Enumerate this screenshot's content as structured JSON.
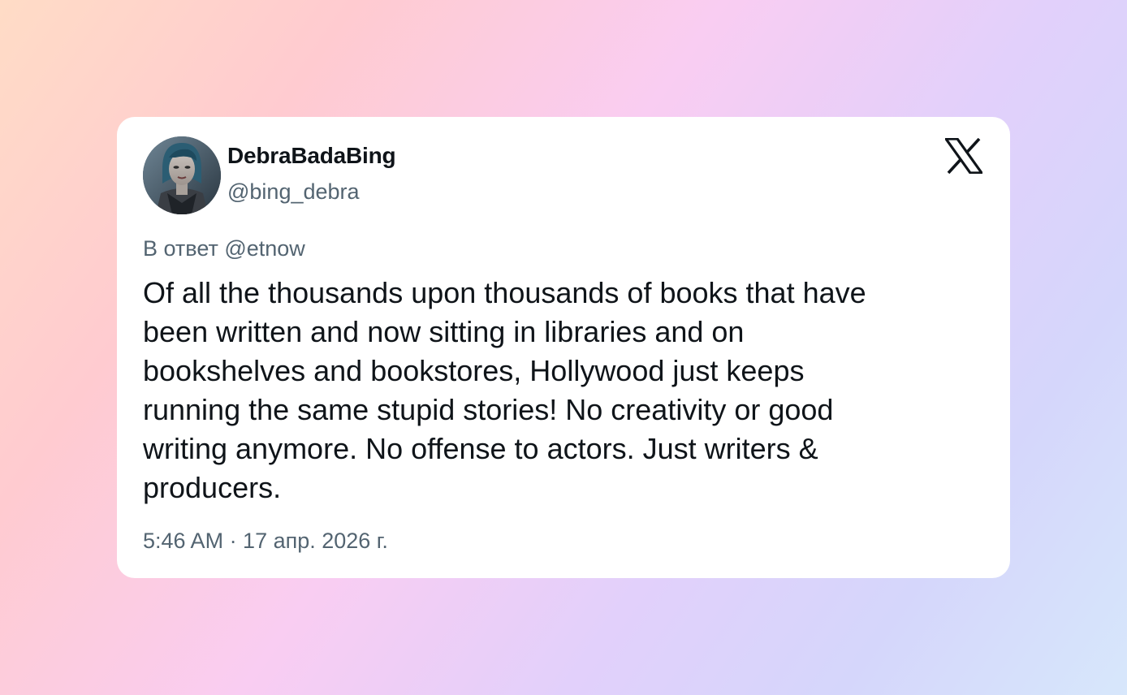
{
  "tweet": {
    "display_name": "DebraBadaBing",
    "handle": "@bing_debra",
    "reply_to": "В ответ @etnow",
    "text": "Of all the thousands upon thousands of books that have\nbeen written and now sitting in libraries and on\nbookshelves and bookstores, Hollywood just keeps\nrunning the same stupid stories! No creativity or good\nwriting anymore. No offense to actors. Just writers &\nproducers.",
    "timestamp": "5:46 AM · 17 апр. 2026 г."
  },
  "icons": {
    "avatar": "avatar-photo",
    "brand": "x-logo-icon"
  },
  "colors": {
    "text_primary": "#0f1419",
    "text_secondary": "#536471",
    "card_background": "#ffffff"
  }
}
